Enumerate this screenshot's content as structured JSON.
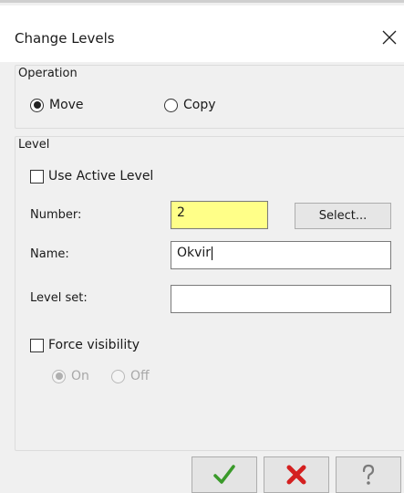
{
  "window": {
    "title": "Change Levels",
    "close_icon": "close-icon"
  },
  "operation": {
    "group_label": "Operation",
    "options": [
      {
        "label": "Move",
        "selected": true
      },
      {
        "label": "Copy",
        "selected": false
      }
    ]
  },
  "level": {
    "group_label": "Level",
    "use_active_level": {
      "label": "Use Active Level",
      "checked": false
    },
    "number": {
      "label": "Number:",
      "value": "2",
      "highlight_color": "#ffff88"
    },
    "select_button": "Select...",
    "name": {
      "label": "Name:",
      "value": "Okvir"
    },
    "level_set": {
      "label": "Level set:",
      "value": ""
    },
    "force_visibility": {
      "label": "Force visibility",
      "checked": false,
      "options": [
        {
          "label": "On",
          "selected": true,
          "disabled": true
        },
        {
          "label": "Off",
          "selected": false,
          "disabled": true
        }
      ]
    }
  },
  "footer": {
    "ok_icon": "checkmark-icon",
    "cancel_icon": "red-x-icon",
    "help_icon": "question-mark-icon",
    "ok_color": "#3a9a2a",
    "cancel_color": "#d42020"
  }
}
